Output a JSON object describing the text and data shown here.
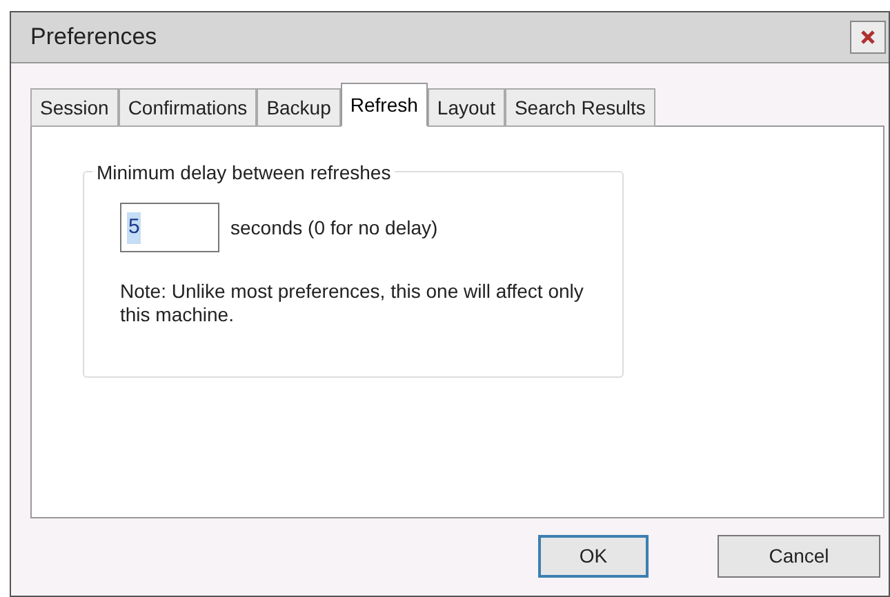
{
  "window": {
    "title": "Preferences"
  },
  "tabs": [
    {
      "label": "Session",
      "selected": false
    },
    {
      "label": "Confirmations",
      "selected": false
    },
    {
      "label": "Backup",
      "selected": false
    },
    {
      "label": "Refresh",
      "selected": true
    },
    {
      "label": "Layout",
      "selected": false
    },
    {
      "label": "Search Results",
      "selected": false
    }
  ],
  "group": {
    "title": "Minimum delay between refreshes",
    "field": {
      "value": "5",
      "selected": true
    },
    "unit_label": "seconds (0 for no delay)",
    "note": "Note: Unlike most preferences, this one will affect only this machine."
  },
  "buttons": [
    {
      "label": "OK",
      "default": true
    },
    {
      "label": "Cancel",
      "default": false
    }
  ]
}
